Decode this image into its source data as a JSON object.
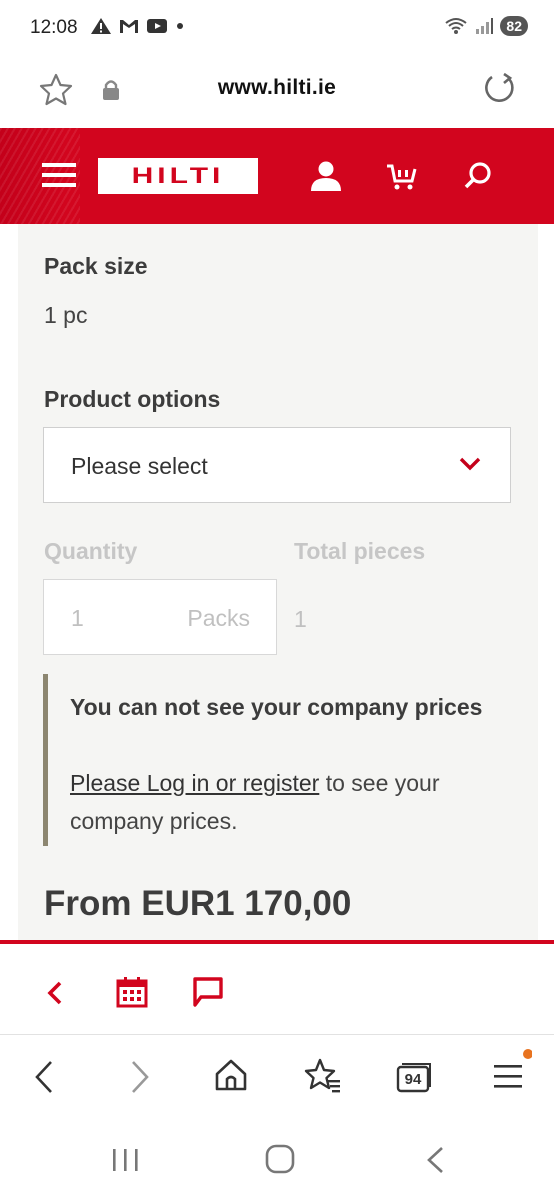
{
  "status": {
    "time": "12:08",
    "battery": "82"
  },
  "browser": {
    "url": "www.hilti.ie",
    "tabs_count": "94"
  },
  "brand": {
    "logo_text": "HILTI",
    "accent": "#d2051e"
  },
  "product": {
    "pack_size_label": "Pack size",
    "pack_size_value": "1 pc",
    "options_label": "Product options",
    "options_placeholder": "Please select",
    "quantity_label": "Quantity",
    "total_pieces_label": "Total pieces",
    "quantity_value": "1",
    "quantity_unit": "Packs",
    "total_pieces_value": "1",
    "notice_title": "You can not see your company prices",
    "notice_link": "Please Log in or register",
    "notice_text": " to see your company prices.",
    "price": "From EUR1 170,00"
  }
}
